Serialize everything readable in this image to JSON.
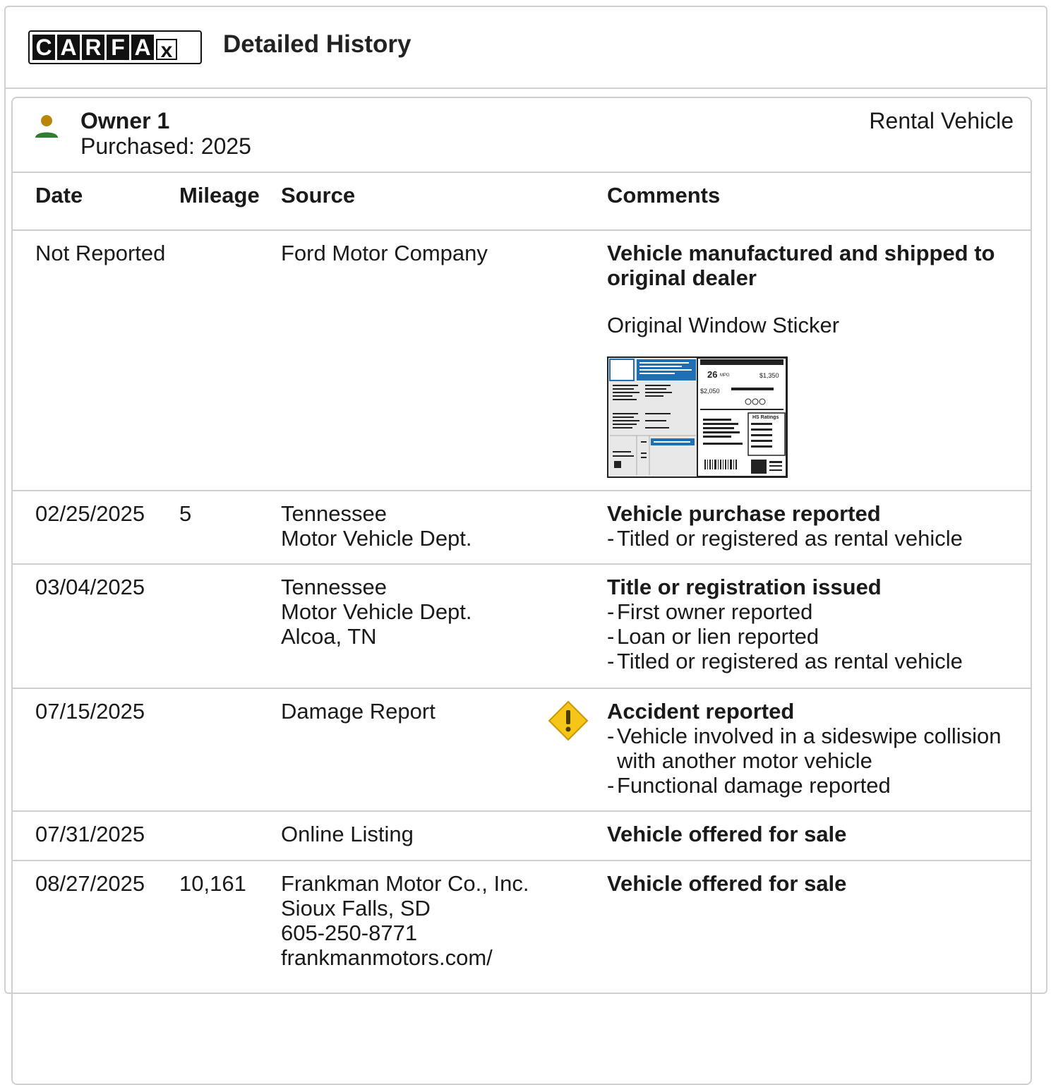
{
  "header": {
    "logo_letters": [
      "C",
      "A",
      "R",
      "F",
      "A",
      "x"
    ],
    "title": "Detailed History"
  },
  "owner": {
    "label": "Owner 1",
    "purchased": "Purchased: 2025",
    "type": "Rental Vehicle"
  },
  "table": {
    "headers": {
      "date": "Date",
      "mileage": "Mileage",
      "source": "Source",
      "comments": "Comments"
    },
    "rows": [
      {
        "date": "Not Reported",
        "mileage": "",
        "source": [
          "Ford Motor Company"
        ],
        "title": "Vehicle manufactured and shipped to original dealer",
        "extra": "Original Window Sticker",
        "bullets": []
      },
      {
        "date": "02/25/2025",
        "mileage": "5",
        "source": [
          "Tennessee",
          "Motor Vehicle Dept."
        ],
        "title": "Vehicle purchase reported",
        "bullets": [
          "Titled or registered as rental vehicle"
        ]
      },
      {
        "date": "03/04/2025",
        "mileage": "",
        "source": [
          "Tennessee",
          "Motor Vehicle Dept.",
          "Alcoa, TN"
        ],
        "title": "Title or registration issued",
        "bullets": [
          "First owner reported",
          "Loan or lien reported",
          "Titled or registered as rental vehicle"
        ]
      },
      {
        "date": "07/15/2025",
        "mileage": "",
        "source": [
          "Damage Report"
        ],
        "title": "Accident reported",
        "bullets": [
          "Vehicle involved in a sideswipe collision with another motor vehicle",
          "Functional damage reported"
        ],
        "icon": "warning-icon"
      },
      {
        "date": "07/31/2025",
        "mileage": "",
        "source": [
          "Online Listing"
        ],
        "title": "Vehicle offered for sale",
        "bullets": []
      },
      {
        "date": "08/27/2025",
        "mileage": "10,161",
        "source": [
          "Frankman Motor Co., Inc.",
          "Sioux Falls, SD",
          "605-250-8771",
          "frankmanmotors.com/"
        ],
        "title": "Vehicle offered for sale",
        "bullets": []
      }
    ]
  },
  "sticker": {
    "mpg": "26",
    "mpg_unit": "MPG",
    "save": "$1,350",
    "annual_cost": "$2,050",
    "ratings_label": "HS Ratings"
  },
  "colors": {
    "owner_head": "#b8860b",
    "owner_body": "#2e7d32",
    "warning": "#f5c518",
    "sticker_blue": "#1f6fb5"
  }
}
